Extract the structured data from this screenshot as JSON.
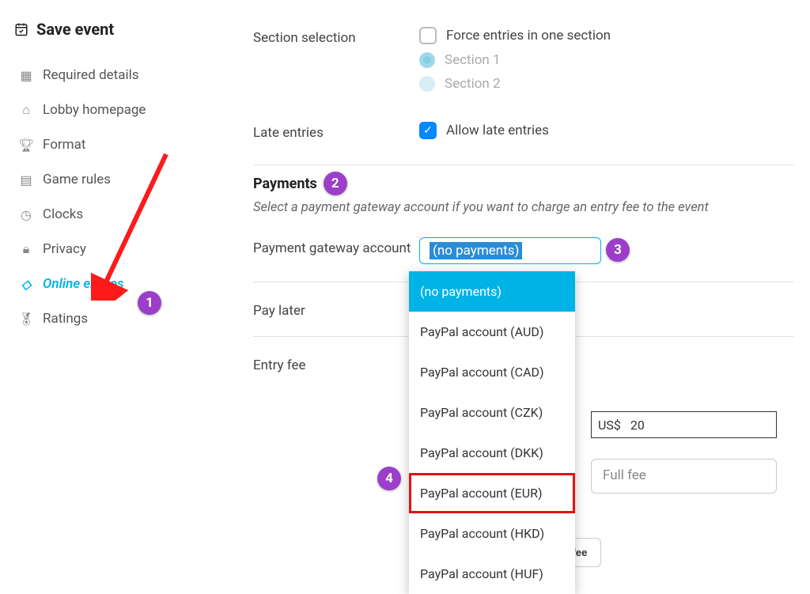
{
  "sidebar": {
    "title": "Save event",
    "items": [
      {
        "label": "Required details"
      },
      {
        "label": "Lobby homepage"
      },
      {
        "label": "Format"
      },
      {
        "label": "Game rules"
      },
      {
        "label": "Clocks"
      },
      {
        "label": "Privacy"
      },
      {
        "label": "Online entries"
      },
      {
        "label": "Ratings"
      }
    ],
    "active_index": 6
  },
  "form": {
    "section_selection": {
      "label": "Section selection",
      "checkbox_label": "Force entries in one section",
      "option1": "Section 1",
      "option2": "Section 2"
    },
    "late_entries": {
      "label": "Late entries",
      "checkbox_label": "Allow late entries",
      "checked": true
    },
    "payments": {
      "heading": "Payments",
      "subtext": "Select a payment gateway account if you want to charge an entry fee to the event"
    },
    "gateway": {
      "label": "Payment gateway account",
      "selected": "(no payments)",
      "options": [
        "(no payments)",
        "PayPal account (AUD)",
        "PayPal account (CAD)",
        "PayPal account (CZK)",
        "PayPal account (DKK)",
        "PayPal account (EUR)",
        "PayPal account (HKD)",
        "PayPal account (HUF)"
      ],
      "selected_index": 0,
      "highlight_index": 5
    },
    "pay_later": {
      "label": "Pay later"
    },
    "entry_fee": {
      "label": "Entry fee",
      "currency_prefix": "US$",
      "amount": "20",
      "fee_name_placeholder": "Full fee",
      "button_visible_text": "ry fee"
    }
  },
  "annotations": {
    "badge1": "1",
    "badge2": "2",
    "badge3": "3",
    "badge4": "4"
  }
}
